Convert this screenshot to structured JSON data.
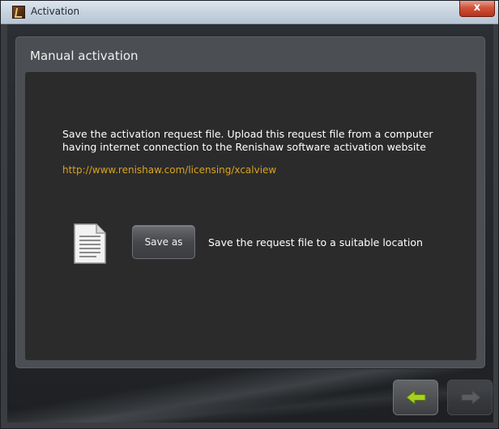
{
  "window": {
    "title": "Activation",
    "close_glyph": "x"
  },
  "panel": {
    "title": "Manual activation",
    "instructions": "Save the activation request file. Upload this request file from a computer having internet connection to the Renishaw software activation website",
    "link": "http://www.renishaw.com/licensing/xcalview"
  },
  "save": {
    "button_label": "Save as",
    "description": "Save the request file to a suitable location",
    "icon": "document-icon"
  },
  "nav": {
    "back_icon": "arrow-left-icon",
    "next_icon": "arrow-right-icon"
  },
  "colors": {
    "link": "#d9a321",
    "back_arrow": "#a6d21e",
    "next_arrow_disabled": "#6d6f72",
    "panel_bg": "#2b2b2b"
  }
}
